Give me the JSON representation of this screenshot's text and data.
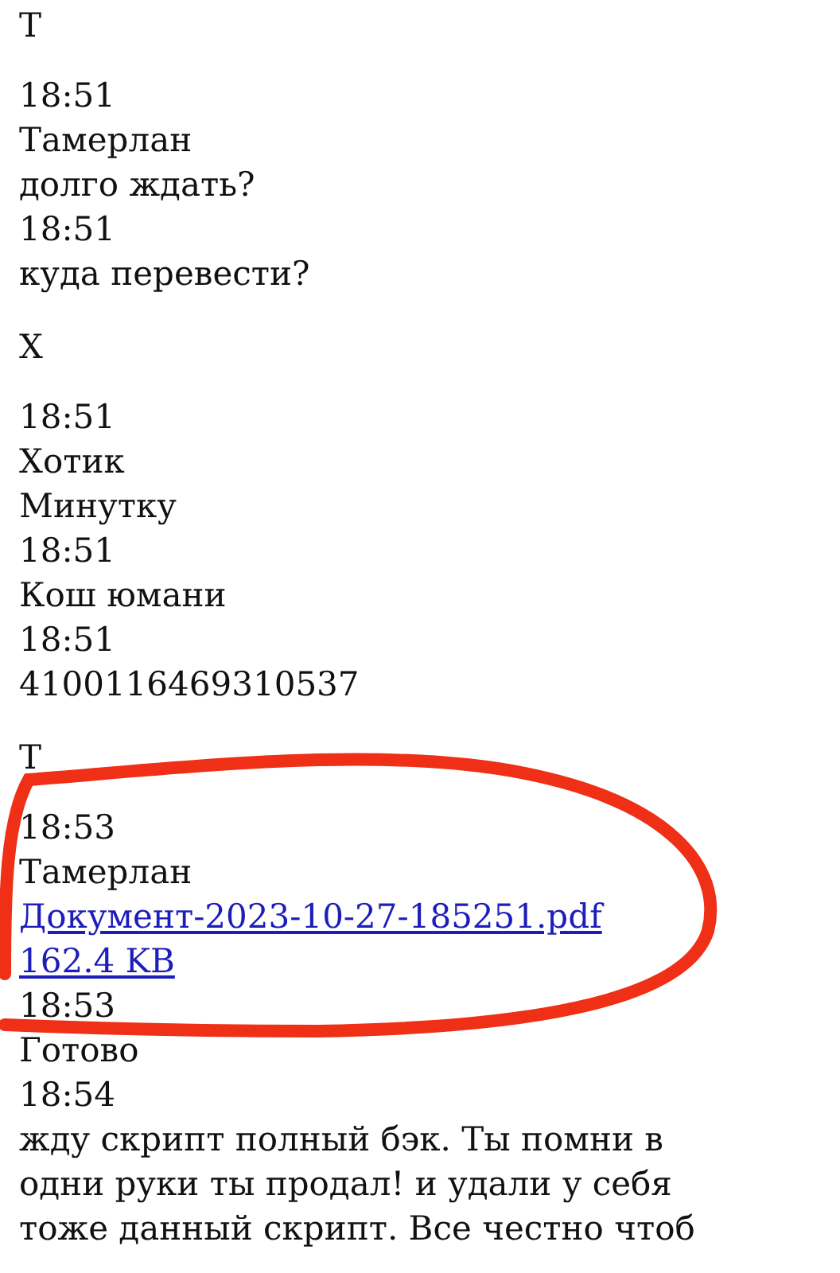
{
  "groups": [
    {
      "initial": "Т",
      "lines": [
        {
          "kind": "time",
          "text": "18:51"
        },
        {
          "kind": "author",
          "text": "Тамерлан"
        },
        {
          "kind": "text",
          "text": "долго ждать?"
        },
        {
          "kind": "time",
          "text": "18:51"
        },
        {
          "kind": "text",
          "text": "куда перевести?"
        }
      ]
    },
    {
      "initial": "Х",
      "lines": [
        {
          "kind": "time",
          "text": "18:51"
        },
        {
          "kind": "author",
          "text": "Хотик"
        },
        {
          "kind": "text",
          "text": "Минутку"
        },
        {
          "kind": "time",
          "text": "18:51"
        },
        {
          "kind": "text",
          "text": "Кош юмани"
        },
        {
          "kind": "time",
          "text": "18:51"
        },
        {
          "kind": "text",
          "text": "4100116469310537"
        }
      ]
    },
    {
      "initial": "Т",
      "lines": [
        {
          "kind": "time",
          "text": "18:53"
        },
        {
          "kind": "author",
          "text": "Тамерлан"
        },
        {
          "kind": "file",
          "text": "Документ-2023-10-27-185251.pdf"
        },
        {
          "kind": "file",
          "text": "162.4 KB"
        },
        {
          "kind": "time",
          "text": "18:53"
        },
        {
          "kind": "text",
          "text": "Готово"
        },
        {
          "kind": "time",
          "text": "18:54"
        },
        {
          "kind": "text",
          "text": "жду скрипт полный бэк. Ты помни в одни руки ты продал! и удали у себя тоже данный скрипт. Все честно чтоб"
        }
      ]
    }
  ],
  "annotation": {
    "kind": "ellipse"
  }
}
